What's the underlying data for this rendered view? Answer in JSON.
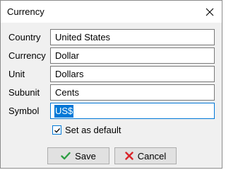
{
  "window": {
    "title": "Currency"
  },
  "form": {
    "fields": [
      {
        "label": "Country",
        "value": "United States"
      },
      {
        "label": "Currency",
        "value": "Dollar"
      },
      {
        "label": "Unit",
        "value": "Dollars"
      },
      {
        "label": "Subunit",
        "value": "Cents"
      },
      {
        "label": "Symbol",
        "value": "US$",
        "selected": true
      }
    ],
    "default_checkbox": {
      "label": "Set as default",
      "checked": true
    }
  },
  "buttons": {
    "save_label": "Save",
    "cancel_label": "Cancel"
  },
  "icons": {
    "close": "close-icon",
    "save": "check-icon",
    "cancel": "x-icon",
    "checkbox": "checkmark-icon"
  },
  "colors": {
    "accent": "#0078d7",
    "save_icon": "#2e9e44",
    "cancel_icon": "#d9252b"
  }
}
